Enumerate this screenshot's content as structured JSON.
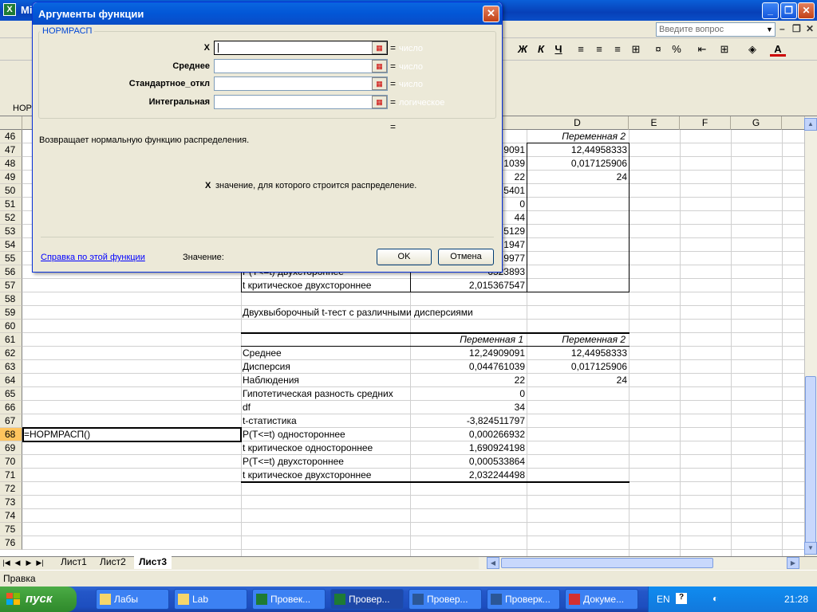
{
  "excel": {
    "title": "Mic",
    "help_placeholder": "Введите вопрос",
    "name_box": "НОРМ",
    "toolbar_visible": [
      "Ж",
      "К",
      "Ч",
      "%"
    ],
    "columns": [
      "D",
      "E",
      "F",
      "G"
    ],
    "status": "Правка",
    "sheet_tabs": [
      "Лист1",
      "Лист2",
      "Лист3"
    ],
    "active_sheet": "Лист3"
  },
  "rows": [
    "46",
    "47",
    "48",
    "49",
    "50",
    "51",
    "52",
    "53",
    "54",
    "55",
    "56",
    "57",
    "58",
    "59",
    "60",
    "61",
    "62",
    "63",
    "64",
    "65",
    "66",
    "67",
    "68",
    "69",
    "70",
    "71",
    "72",
    "73",
    "74",
    "75",
    "76"
  ],
  "sheet": {
    "upper": {
      "d_header": "Переменная 2",
      "c_partial": [
        "9091",
        "1039",
        "22",
        "5401",
        "0",
        "44",
        "5129",
        "1947",
        "9977",
        "6523893",
        "2,015367547"
      ],
      "d_values": [
        "12,44958333",
        "0,017125906",
        "24"
      ],
      "b_partial_56": "P(T<=t) двухстороннее",
      "b_57": "t критическое двухстороннее"
    },
    "lower": {
      "title": "Двухвыборочный t-тест с различными дисперсиями",
      "header_c": "Переменная 1",
      "header_d": "Переменная 2",
      "labels": [
        "Среднее",
        "Дисперсия",
        "Наблюдения",
        "Гипотетическая разность средних",
        "df",
        "t-статистика",
        "P(T<=t) одностороннее",
        "t критическое одностороннее",
        "P(T<=t) двухстороннее",
        "t критическое двухстороннее"
      ],
      "values_c": [
        "12,24909091",
        "0,044761039",
        "22",
        "0",
        "34",
        "-3,824511797",
        "0,000266932",
        "1,690924198",
        "0,000533864",
        "2,032244498"
      ],
      "values_d": [
        "12,44958333",
        "0,017125906",
        "24"
      ]
    },
    "active_cell_text": "=НОРМРАСП()"
  },
  "dialog": {
    "title": "Аргументы функции",
    "group_label": "НОРМРАСП",
    "args": [
      {
        "label": "X",
        "type": "число"
      },
      {
        "label": "Среднее",
        "type": "число"
      },
      {
        "label": "Стандартное_откл",
        "type": "число"
      },
      {
        "label": "Интегральная",
        "type": "логическое"
      }
    ],
    "eq": "=",
    "description": "Возвращает нормальную функцию распределения.",
    "arg_help_name": "X",
    "arg_help_text": "значение, для которого строится распределение.",
    "help_link": "Справка по этой функции",
    "value_label": "Значение:",
    "ok": "OK",
    "cancel": "Отмена"
  },
  "taskbar": {
    "start": "пуск",
    "tasks": [
      "Лабы",
      "Lab",
      "Провек...",
      "Провер...",
      "Провер...",
      "Проверк...",
      "Докуме..."
    ],
    "lang": "EN",
    "clock": "21:28"
  }
}
